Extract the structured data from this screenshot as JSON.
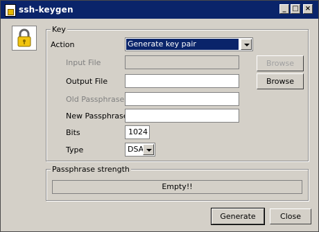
{
  "window": {
    "title": "ssh-keygen"
  },
  "key_group": {
    "legend": "Key",
    "action_label": "Action",
    "action_value": "Generate key pair",
    "input_file_label": "Input File",
    "input_file_value": "",
    "output_file_label": "Output File",
    "output_file_value": "",
    "old_passphrase_label": "Old Passphrase",
    "old_passphrase_value": "",
    "new_passphrase_label": "New Passphrase",
    "new_passphrase_value": "",
    "bits_label": "Bits",
    "bits_value": "1024",
    "type_label": "Type",
    "type_value": "DSA",
    "browse_input_label": "Browse",
    "browse_output_label": "Browse"
  },
  "strength_group": {
    "legend": "Passphrase strength",
    "status": "Empty!!"
  },
  "buttons": {
    "generate_label": "Generate",
    "close_label": "Close"
  },
  "icons": {
    "lock": "lock-icon",
    "title": "keygen-app-icon"
  }
}
